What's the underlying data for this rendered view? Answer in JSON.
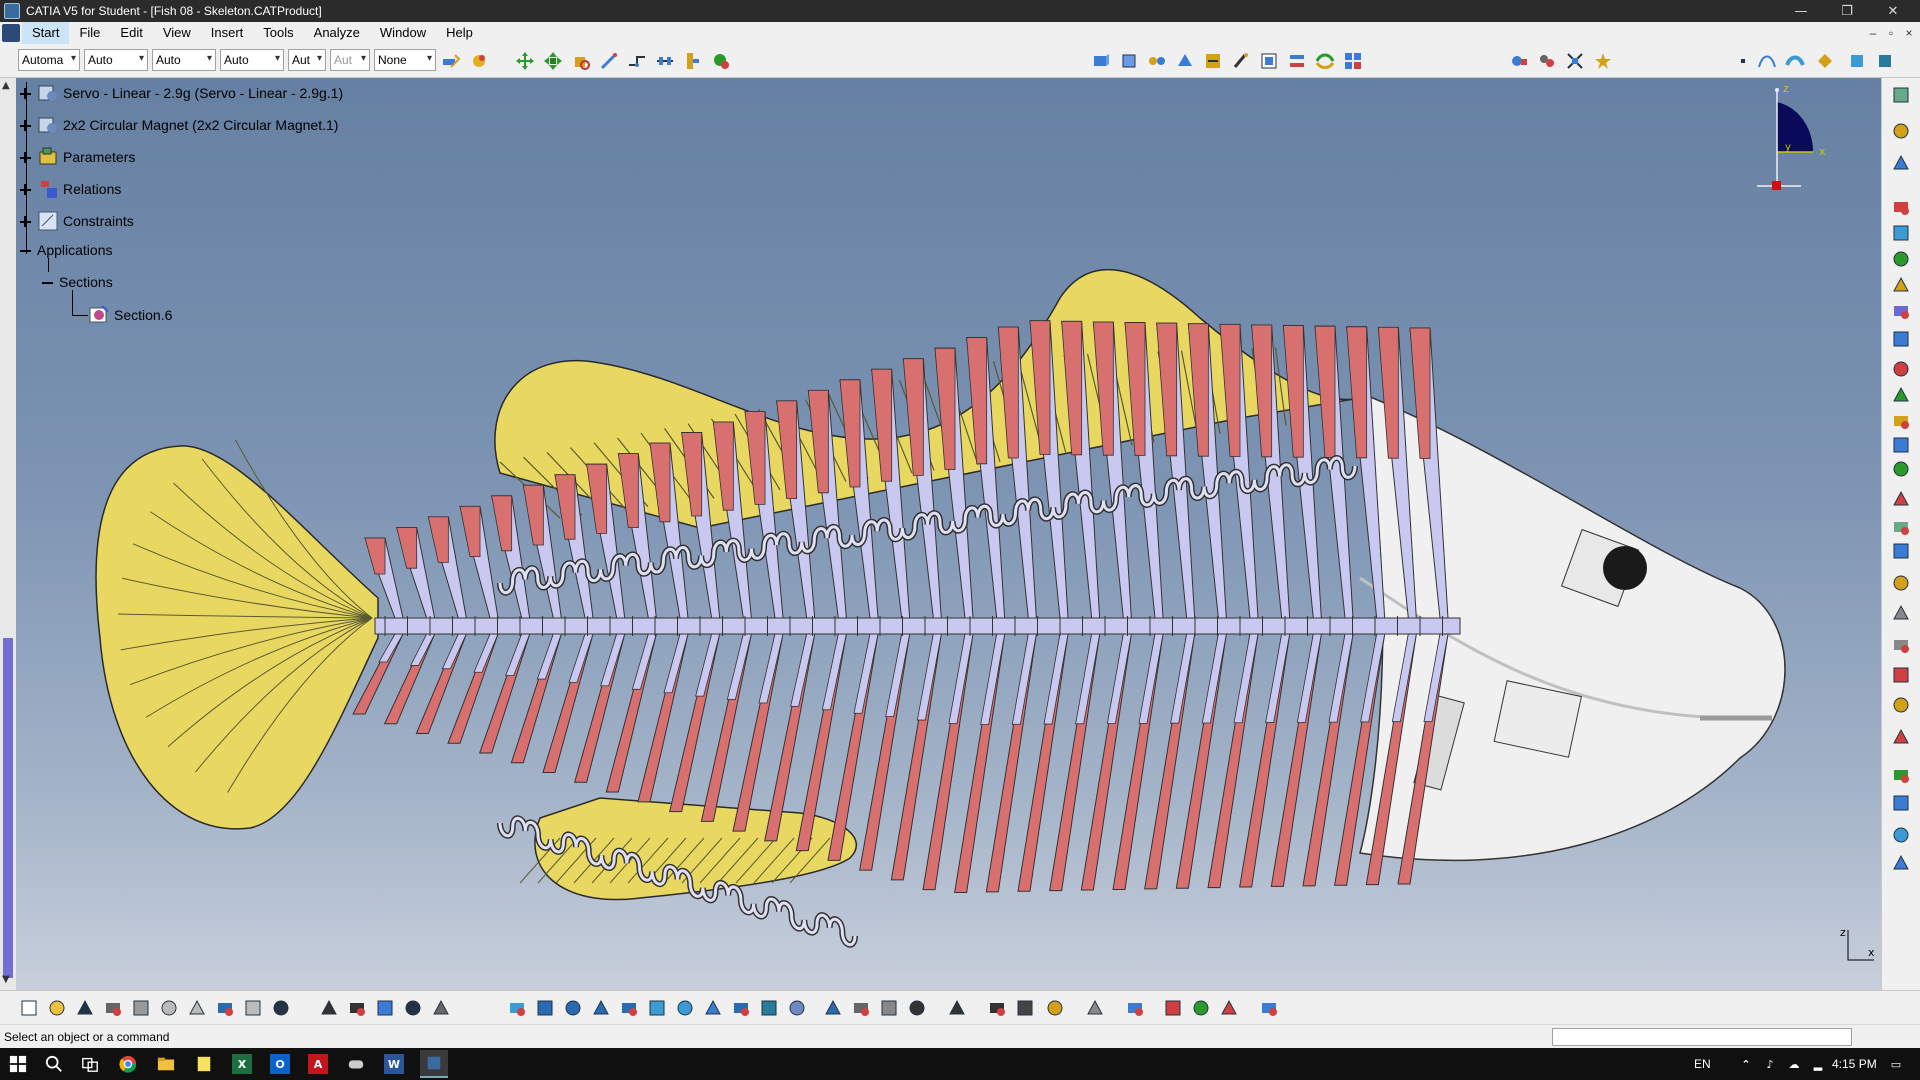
{
  "window": {
    "title": "CATIA V5 for Student - [Fish 08 - Skeleton.CATProduct]",
    "controls": [
      "—",
      "❐",
      "✕"
    ],
    "doc_controls": [
      "–",
      "▫",
      "×"
    ]
  },
  "menu": {
    "items": [
      "Start",
      "File",
      "Edit",
      "View",
      "Insert",
      "Tools",
      "Analyze",
      "Window",
      "Help"
    ]
  },
  "toolbar": {
    "combos": [
      "Automa",
      "Auto",
      "Auto",
      "Auto",
      "Aut",
      "Aut",
      "None"
    ]
  },
  "tree": {
    "nodes": [
      {
        "label": "Servo - Linear - 2.9g (Servo - Linear - 2.9g.1)",
        "icon": "part-instance-icon"
      },
      {
        "label": "2x2 Circular Magnet (2x2 Circular Magnet.1)",
        "icon": "part-instance-icon"
      },
      {
        "label": "Parameters",
        "icon": "parameters-icon"
      },
      {
        "label": "Relations",
        "icon": "relations-icon"
      },
      {
        "label": "Constraints",
        "icon": "constraints-icon"
      },
      {
        "label": "Applications",
        "icon": ""
      },
      {
        "label": "Sections",
        "icon": ""
      },
      {
        "label": "Section.6",
        "icon": "section-icon"
      }
    ]
  },
  "compass": {
    "z": "z",
    "x": "x",
    "y": "y"
  },
  "axis": {
    "z": "z",
    "x": "x"
  },
  "status": {
    "message": "Select an object or a command"
  },
  "taskbar": {
    "lang": "EN",
    "time": "4:15 PM"
  },
  "colors": {
    "fin": "#e8d862",
    "rib_red": "#d8706f",
    "rib_lavender": "#c8c8f0",
    "head": "#f0f0f0",
    "viewport_top": "#6680a3",
    "viewport_bottom": "#c8cfdc"
  }
}
